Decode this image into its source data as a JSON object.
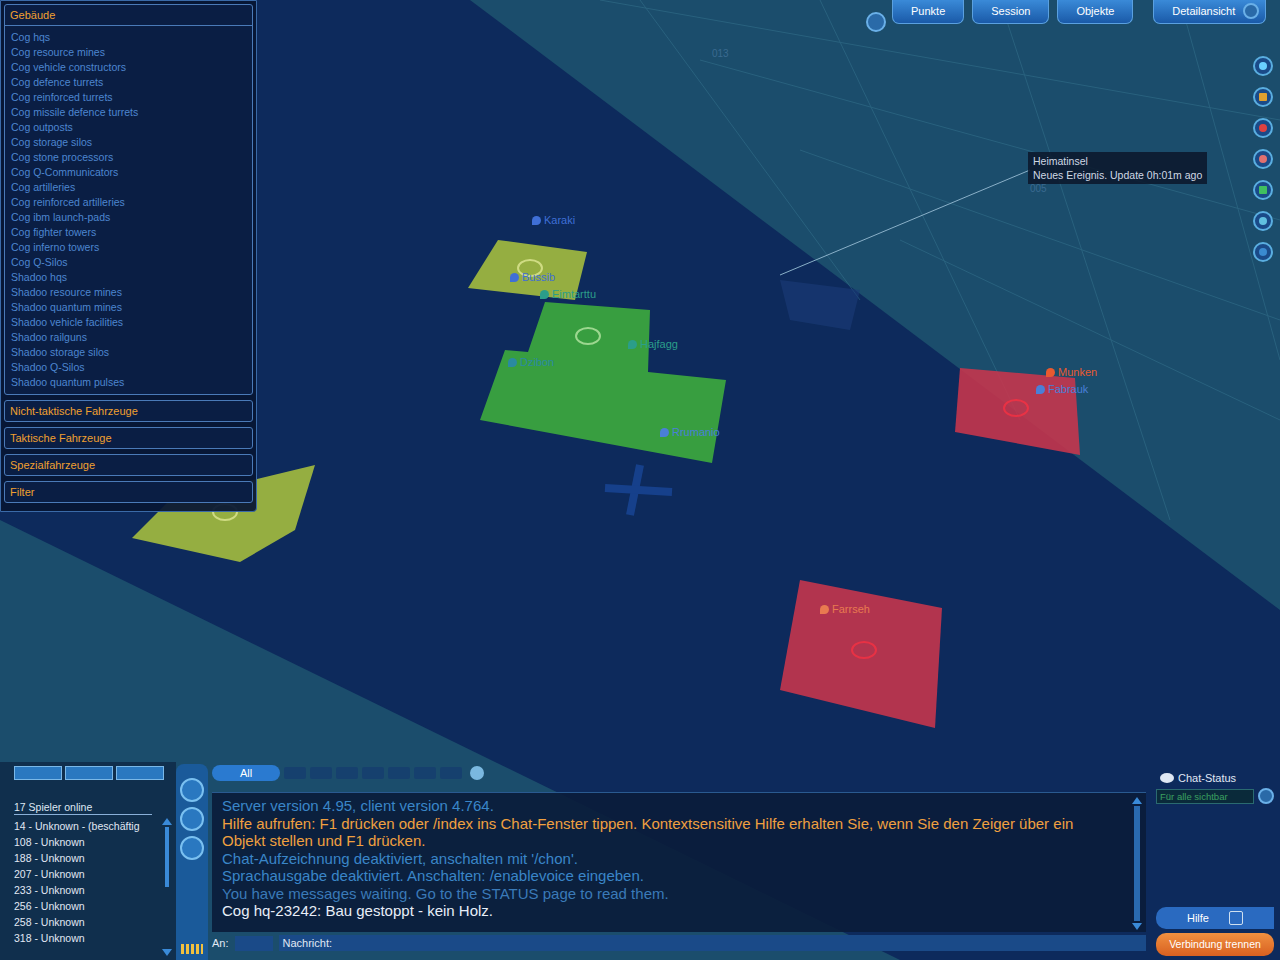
{
  "panel": {
    "sections": [
      {
        "label": "Gebäude",
        "expanded": true,
        "items": [
          "Cog hqs",
          "Cog resource mines",
          "Cog vehicle constructors",
          "Cog defence turrets",
          "Cog reinforced turrets",
          "Cog missile defence turrets",
          "Cog outposts",
          "Cog storage silos",
          "Cog stone processors",
          "Cog Q-Communicators",
          "Cog artilleries",
          "Cog reinforced artilleries",
          "Cog ibm launch-pads",
          "Cog fighter towers",
          "Cog inferno towers",
          "Cog Q-Silos",
          "Shadoo hqs",
          "Shadoo resource mines",
          "Shadoo quantum mines",
          "Shadoo vehicle facilities",
          "Shadoo railguns",
          "Shadoo storage silos",
          "Shadoo Q-Silos",
          "Shadoo quantum pulses"
        ]
      },
      {
        "label": "Nicht-taktische Fahrzeuge",
        "expanded": false,
        "items": []
      },
      {
        "label": "Taktische Fahrzeuge",
        "expanded": false,
        "items": []
      },
      {
        "label": "Spezialfahrzeuge",
        "expanded": false,
        "items": []
      },
      {
        "label": "Filter",
        "expanded": false,
        "items": []
      }
    ]
  },
  "top_buttons": [
    "Punkte",
    "Session",
    "Objekte",
    "Detailansicht"
  ],
  "map": {
    "grid_labels": [
      "013",
      "005"
    ],
    "tiles": [
      {
        "color": "#a9c03e"
      },
      {
        "color": "#3fae3c"
      },
      {
        "color": "#a9c03e"
      },
      {
        "color": "#c9364c"
      },
      {
        "color": "#c9364c"
      }
    ],
    "markers": [
      {
        "name": "Karaki",
        "color": "#3f6fd6"
      },
      {
        "name": "Bussib",
        "color": "#3f6fd6"
      },
      {
        "name": "Eimtarttu",
        "color": "#2b9e8a"
      },
      {
        "name": "Hajfagg",
        "color": "#2b9e8a"
      },
      {
        "name": "Dzibon",
        "color": "#2a8aa0"
      },
      {
        "name": "Rrumanio",
        "color": "#4a7fd8"
      },
      {
        "name": "Munken",
        "color": "#e85a30"
      },
      {
        "name": "Fabrauk",
        "color": "#4a7fd8"
      },
      {
        "name": "Farrseh",
        "color": "#e87a50"
      }
    ],
    "tooltip": {
      "title": "Heimatinsel",
      "text": "Neues Ereignis. Update 0h:01m ago"
    }
  },
  "players": {
    "title": "17 Spieler online",
    "items": [
      "14 - Unknown - (beschäftig",
      "108 - Unknown",
      "188 - Unknown",
      "207 - Unknown",
      "233 - Unknown",
      "256 - Unknown",
      "258 - Unknown",
      "318 - Unknown"
    ]
  },
  "chat": {
    "tabs": [
      {
        "label": "All",
        "selected": true
      }
    ],
    "messages": [
      {
        "text": "Server version 4.95, client version 4.764.",
        "color": "#3a86c8"
      },
      {
        "text": "Hilfe aufrufen: F1 drücken oder /index ins Chat-Fenster tippen. Kontextsensitive Hilfe erhalten Sie, wenn Sie den Zeiger über ein Objekt stellen und F1 drücken.",
        "color": "#f0a040"
      },
      {
        "text": "Chat-Aufzeichnung deaktiviert, anschalten mit '/chon'.",
        "color": "#3a86c8"
      },
      {
        "text": "Sprachausgabe deaktiviert. Anschalten: /enablevoice eingeben.",
        "color": "#3a86c8"
      },
      {
        "text": "You have messages waiting. Go to the STATUS page to read them.",
        "color": "#3a7ab8"
      },
      {
        "text": "Cog hq-23242: Bau gestoppt - kein Holz.",
        "color": "#e8eef8"
      }
    ],
    "to_label": "An:",
    "message_label": "Nachricht:"
  },
  "chat_status": {
    "label": "Chat-Status",
    "visibility": "Für alle sichtbar"
  },
  "buttons": {
    "help": "Hilfe",
    "disconnect": "Verbindung trennen"
  }
}
